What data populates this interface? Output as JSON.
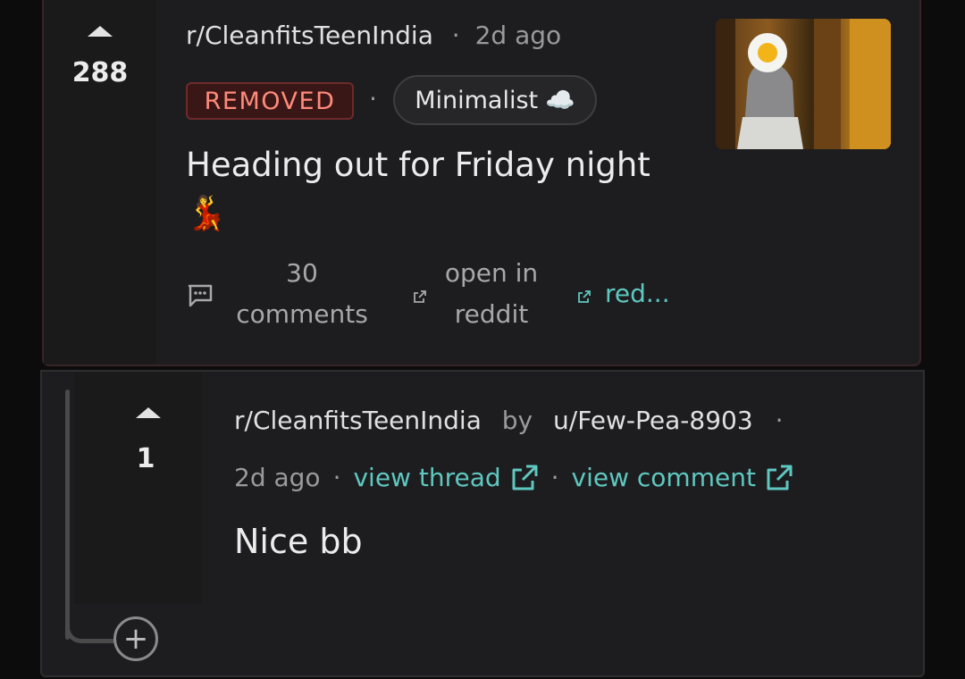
{
  "post": {
    "score": "288",
    "subreddit": "r/CleanfitsTeenIndia",
    "separator": "·",
    "time": "2d ago",
    "status_badge": "REMOVED",
    "flair": "Minimalist",
    "flair_emoji": "☁️",
    "title": "Heading out for Friday night 💃",
    "actions": {
      "comments": "30 comments",
      "open_in_reddit": "open in reddit",
      "reddit_link": "red..."
    }
  },
  "comment": {
    "score": "1",
    "subreddit": "r/CleanfitsTeenIndia",
    "by": "by",
    "user": "u/Few-Pea-8903",
    "separator": "·",
    "time": "2d ago",
    "view_thread": "view thread",
    "view_comment": "view comment",
    "body": "Nice bb",
    "expand": "+"
  },
  "colors": {
    "accent_link": "#5ec8c0",
    "removed_text": "#ff8a7a",
    "background": "#1d1d1f"
  }
}
